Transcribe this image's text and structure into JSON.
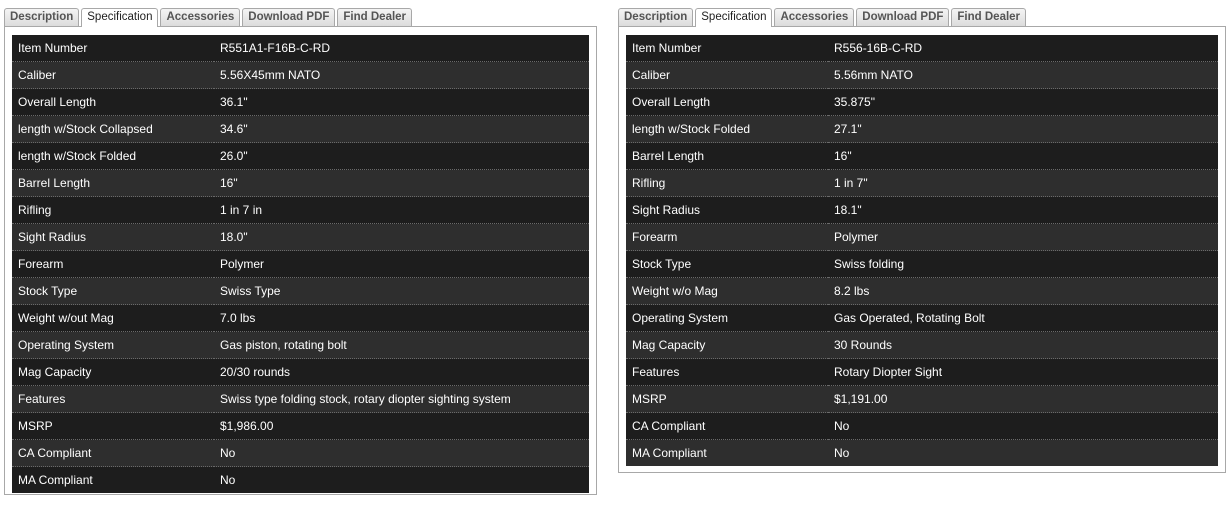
{
  "tabs": [
    "Description",
    "Specification",
    "Accessories",
    "Download PDF",
    "Find Dealer"
  ],
  "active_tab": "Specification",
  "left_specs": [
    {
      "label": "Item Number",
      "value": "R551A1-F16B-C-RD"
    },
    {
      "label": "Caliber",
      "value": "5.56X45mm NATO"
    },
    {
      "label": "Overall Length",
      "value": "36.1\""
    },
    {
      "label": "length w/Stock Collapsed",
      "value": "34.6\""
    },
    {
      "label": "length w/Stock Folded",
      "value": "26.0\""
    },
    {
      "label": "Barrel Length",
      "value": "16\""
    },
    {
      "label": "Rifling",
      "value": "1 in 7 in"
    },
    {
      "label": "Sight Radius",
      "value": "18.0\""
    },
    {
      "label": "Forearm",
      "value": "Polymer"
    },
    {
      "label": "Stock Type",
      "value": "Swiss Type"
    },
    {
      "label": "Weight w/out Mag",
      "value": "7.0 lbs"
    },
    {
      "label": "Operating System",
      "value": "Gas piston, rotating bolt"
    },
    {
      "label": "Mag Capacity",
      "value": "20/30 rounds"
    },
    {
      "label": "Features",
      "value": "Swiss type folding stock, rotary diopter sighting system"
    },
    {
      "label": "MSRP",
      "value": "$1,986.00"
    },
    {
      "label": "CA Compliant",
      "value": "No"
    },
    {
      "label": "MA Compliant",
      "value": "No"
    }
  ],
  "right_specs": [
    {
      "label": "Item Number",
      "value": "R556-16B-C-RD"
    },
    {
      "label": "Caliber",
      "value": "5.56mm NATO"
    },
    {
      "label": "Overall Length",
      "value": "35.875\""
    },
    {
      "label": "length w/Stock Folded",
      "value": "27.1\""
    },
    {
      "label": "Barrel Length",
      "value": "16\""
    },
    {
      "label": "Rifling",
      "value": "1 in 7\""
    },
    {
      "label": "Sight Radius",
      "value": "18.1\""
    },
    {
      "label": "Forearm",
      "value": "Polymer"
    },
    {
      "label": "Stock Type",
      "value": "Swiss folding"
    },
    {
      "label": "Weight w/o Mag",
      "value": "8.2 lbs"
    },
    {
      "label": "Operating System",
      "value": "Gas Operated, Rotating Bolt"
    },
    {
      "label": "Mag Capacity",
      "value": "30 Rounds"
    },
    {
      "label": "Features",
      "value": "Rotary Diopter Sight"
    },
    {
      "label": "MSRP",
      "value": "$1,191.00"
    },
    {
      "label": "CA Compliant",
      "value": "No"
    },
    {
      "label": "MA Compliant",
      "value": "No"
    }
  ]
}
